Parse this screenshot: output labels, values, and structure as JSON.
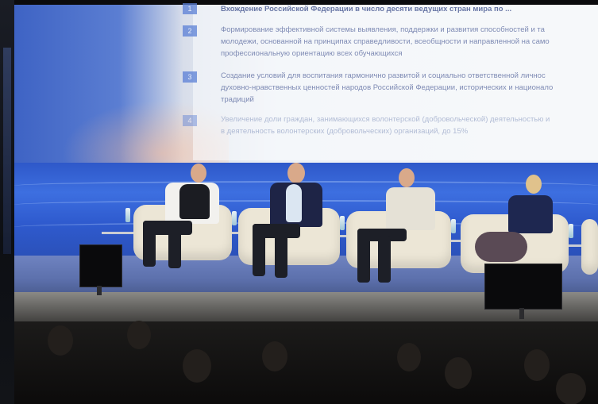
{
  "scene": "panel discussion on stage",
  "slide": {
    "items": [
      {
        "number": "1",
        "text": "Вхождение Российской Федерации в число десяти ведущих стран мира по ..."
      },
      {
        "number": "2",
        "text": "Формирование эффективной системы выявления, поддержки и развития способностей и та",
        "line2": "молодежи, основанной на принципах справедливости, всеобщности и направленной на само",
        "line3": "профессиональную ориентацию всех обучающихся"
      },
      {
        "number": "3",
        "text": "Создание условий для воспитания гармонично развитой и социально ответственной личнос",
        "line2": "духовно-нравственных ценностей народов Российской Федерации, исторических и национало",
        "line3": "традиций"
      },
      {
        "number": "4",
        "text": "Увеличение доли граждан, занимающихся волонтерской (добровольческой) деятельностью и",
        "line2": "в деятельность волонтерских (добровольческих) организаций, до 15%"
      }
    ]
  },
  "colors": {
    "stage_blue": "#2f5bcf",
    "chair": "#ece6d6",
    "slide_accent": "#5a7fd6"
  }
}
